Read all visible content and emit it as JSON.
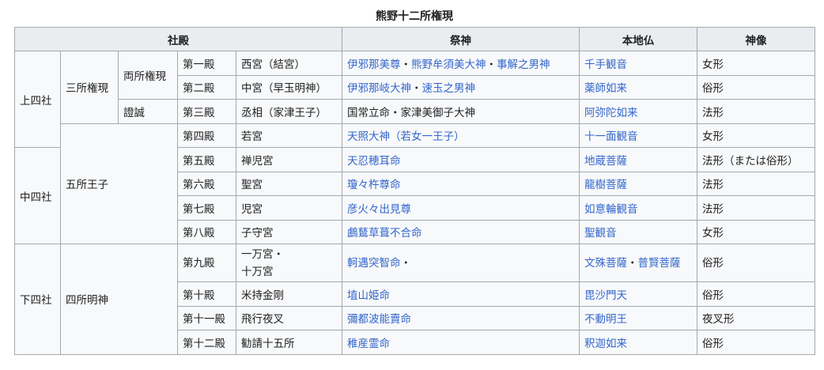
{
  "title": "熊野十二所権現",
  "headers": {
    "shaden": "社殿",
    "saijin": "祭神",
    "honjibutsu": "本地仏",
    "shinzo": "神像"
  },
  "groups": {
    "kamishisha": "上四社",
    "nakashisha": "中四社",
    "shimoshisha": "下四社",
    "sansho_gongen": "三所権現",
    "ryosho_gongen": "両所権現",
    "shosho": "證誠",
    "gosho_oji": "五所王子",
    "shisho_myojin": "四所明神"
  },
  "rows": [
    {
      "den": "第一殿",
      "name": "西宮（結宮）",
      "deity": "伊邪那美尊・熊野牟須美大神・事解之男神",
      "honji": "千手観音",
      "zo": "女形"
    },
    {
      "den": "第二殿",
      "name": "中宮（早玉明神）",
      "deity": "伊邪那岐大神・速玉之男神",
      "honji": "薬師如来",
      "zo": "俗形"
    },
    {
      "den": "第三殿",
      "name": "丞相（家津王子）",
      "deity": "国常立命・家津美御子大神",
      "honji": "阿弥陀如来",
      "zo": "法形"
    },
    {
      "den": "第四殿",
      "name": "若宮",
      "deity": "天照大神（若女一王子）",
      "honji": "十一面観音",
      "zo": "女形"
    },
    {
      "den": "第五殿",
      "name": "禅児宮",
      "deity": "天忍穂耳命",
      "honji": "地蔵菩薩",
      "zo": "法形（または俗形）"
    },
    {
      "den": "第六殿",
      "name": "聖宮",
      "deity": "瓊々杵尊命",
      "honji": "龍樹菩薩",
      "zo": "法形"
    },
    {
      "den": "第七殿",
      "name": "児宮",
      "deity": "彦火々出見尊",
      "honji": "如意輪観音",
      "zo": "法形"
    },
    {
      "den": "第八殿",
      "name": "子守宮",
      "deity": "鸕鶿草葺不合命",
      "honji": "聖観音",
      "zo": "女形"
    },
    {
      "den": "第九殿",
      "name": "一万宮・十万宮",
      "deity": "軻遇突智命・",
      "honji": "文殊菩薩・普賢菩薩",
      "zo": "俗形"
    },
    {
      "den": "第十殿",
      "name": "米持金剛",
      "deity": "埴山姫命",
      "honji": "毘沙門天",
      "zo": "俗形"
    },
    {
      "den": "第十一殿",
      "name": "飛行夜叉",
      "deity": "彌都波能賣命",
      "honji": "不動明王",
      "zo": "夜叉形"
    },
    {
      "den": "第十二殿",
      "name": "勧請十五所",
      "deity": "稚産霊命",
      "honji": "釈迦如来",
      "zo": "俗形"
    }
  ]
}
